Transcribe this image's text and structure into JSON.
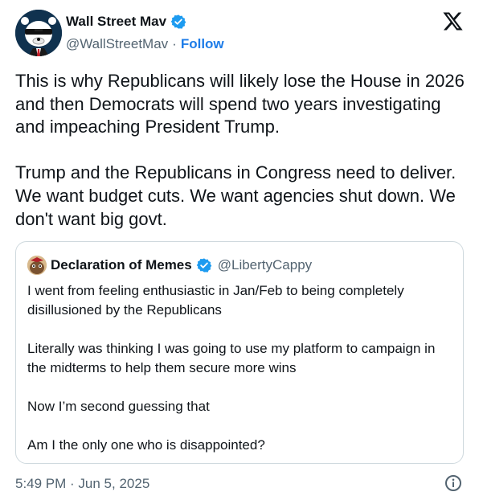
{
  "author": {
    "name": "Wall Street Mav",
    "handle": "@WallStreetMav",
    "separator": "·",
    "follow_label": "Follow",
    "verified_color": "#1d9bf0"
  },
  "tweet": {
    "paragraphs": [
      "This is why Republicans will likely lose the House in 2026 and then Democrats will spend two years investigating and impeaching President Trump.",
      "Trump and the Republicans in Congress need to deliver. We want budget cuts. We want agencies shut down. We don't want big govt."
    ]
  },
  "quoted": {
    "name": "Declaration of Memes",
    "handle": "@LibertyCappy",
    "paragraphs": [
      "I went from feeling enthusiastic in Jan/Feb to being completely disillusioned by the Republicans",
      "Literally was thinking I was going to use my platform to campaign in the midterms to help them secure more wins",
      "Now I’m second guessing that",
      "Am I the only one who is disappointed?"
    ]
  },
  "meta": {
    "timestamp": "5:49 PM · Jun 5, 2025"
  },
  "icons": {
    "brand": "x-logo-icon",
    "verified": "verified-badge-icon",
    "info": "info-icon"
  },
  "colors": {
    "text": "#0f1419",
    "secondary": "#536471",
    "follow": "#1d7ce8",
    "border": "#cfd9de"
  }
}
